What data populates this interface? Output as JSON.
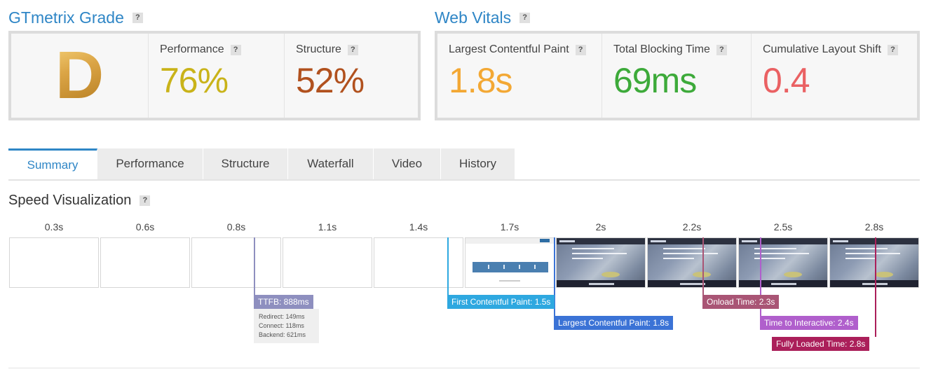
{
  "grade": {
    "title": "GTmetrix Grade",
    "help": "?",
    "letter": "D",
    "performance": {
      "label": "Performance",
      "value": "76%",
      "color": "#c9b319"
    },
    "structure": {
      "label": "Structure",
      "value": "52%",
      "color": "#b1511e"
    }
  },
  "vitals": {
    "title": "Web Vitals",
    "help": "?",
    "lcp": {
      "label": "Largest Contentful Paint",
      "value": "1.8s",
      "color": "#f3a834"
    },
    "tbt": {
      "label": "Total Blocking Time",
      "value": "69ms",
      "color": "#3daa3a"
    },
    "cls": {
      "label": "Cumulative Layout Shift",
      "value": "0.4",
      "color": "#ea6163"
    }
  },
  "tabs": [
    "Summary",
    "Performance",
    "Structure",
    "Waterfall",
    "Video",
    "History"
  ],
  "active_tab": "Summary",
  "speed": {
    "title": "Speed Visualization",
    "help": "?",
    "times": [
      "0.3s",
      "0.6s",
      "0.8s",
      "1.1s",
      "1.4s",
      "1.7s",
      "2s",
      "2.2s",
      "2.5s",
      "2.8s"
    ]
  },
  "markers": {
    "ttfb": {
      "label": "TTFB: 888ms",
      "color": "#8e8fbf"
    },
    "ttfb_details": [
      "Redirect: 149ms",
      "Connect: 118ms",
      "Backend: 621ms"
    ],
    "fcp": {
      "label": "First Contentful Paint: 1.5s",
      "color": "#2ea8e0"
    },
    "lcp": {
      "label": "Largest Contentful Paint: 1.8s",
      "color": "#3b73d6"
    },
    "onload": {
      "label": "Onload Time: 2.3s",
      "color": "#a95575"
    },
    "tti": {
      "label": "Time to Interactive: 2.4s",
      "color": "#b05fcc"
    },
    "fully_loaded": {
      "label": "Fully Loaded Time: 2.8s",
      "color": "#ab1f5a"
    }
  }
}
